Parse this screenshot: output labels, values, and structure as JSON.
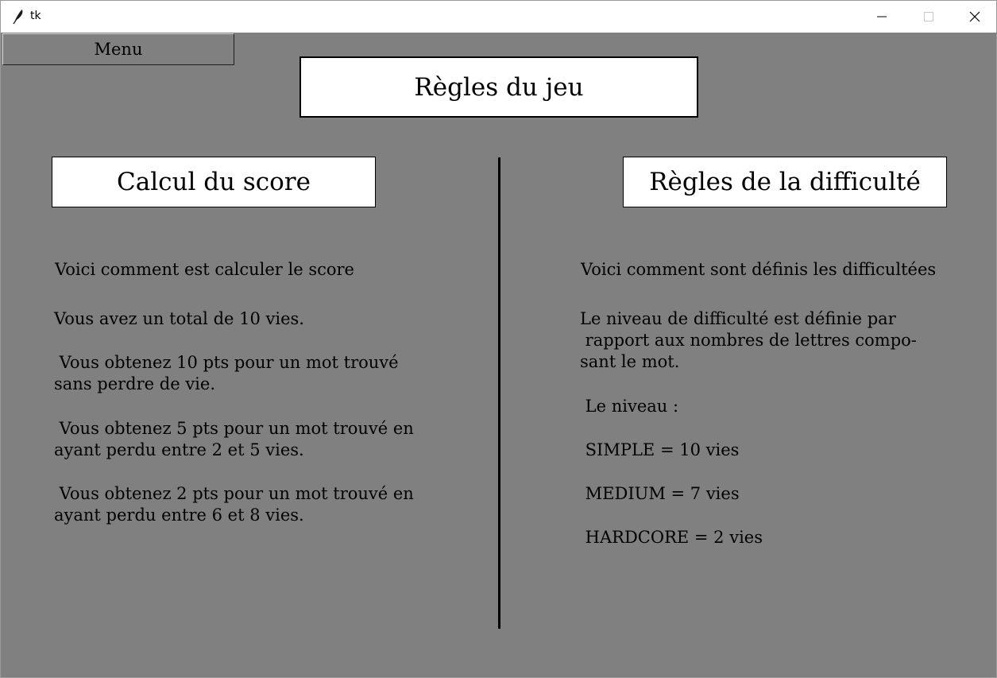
{
  "window": {
    "title": "tk",
    "icon": "feather-icon",
    "controls": [
      "minimize-icon",
      "maximize-icon",
      "close-icon"
    ]
  },
  "menu_button": {
    "label": "Menu"
  },
  "main_title": "Règles du jeu",
  "score": {
    "heading": "Calcul du score",
    "intro": "Voici comment est calculer le score",
    "total_lives": "Vous avez un total de 10 vies.",
    "rule_10": " Vous obtenez 10 pts pour un mot trouvé\nsans perdre de vie.",
    "rule_5": " Vous obtenez 5 pts pour un mot trouvé en\nayant perdu entre 2 et 5 vies.",
    "rule_2": " Vous obtenez 2 pts pour un mot trouvé en\nayant perdu entre 6 et 8 vies."
  },
  "difficulty": {
    "heading": "Règles de la difficulté",
    "intro": "Voici comment sont définis les difficultées",
    "definition": "Le niveau de difficulté est définie par\n rapport aux nombres de lettres compo-\nsant le mot.",
    "level_label": " Le niveau :",
    "simple": " SIMPLE = 10 vies",
    "medium": " MEDIUM = 7 vies",
    "hardcore": " HARDCORE = 2 vies"
  },
  "colors": {
    "background": "#808080",
    "panel": "#ffffff",
    "text": "#000000"
  }
}
